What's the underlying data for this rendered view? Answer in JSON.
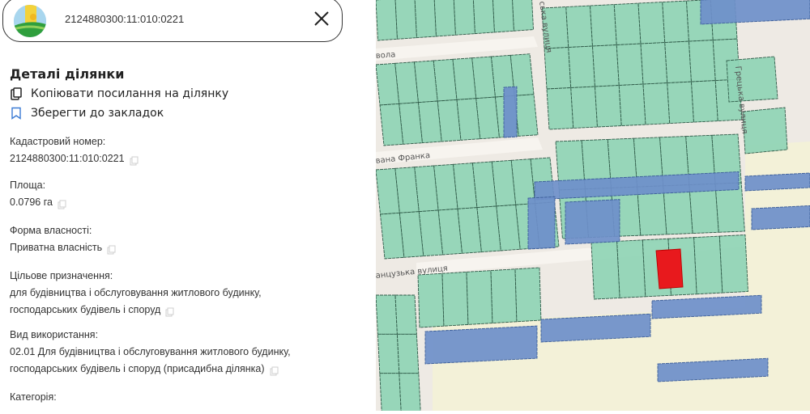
{
  "search": {
    "value": "2124880300:11:010:0221"
  },
  "details": {
    "title": "Деталі ділянки",
    "copy_link_label": "Копіювати посилання на ділянку",
    "bookmark_label": "Зберегти до закладок",
    "fields": [
      {
        "label": "Кадастровий номер:",
        "lines": [
          "2124880300:11:010:0221"
        ]
      },
      {
        "label": "Площа:",
        "lines": [
          "0.0796 га"
        ]
      },
      {
        "label": "Форма власності:",
        "lines": [
          "Приватна власність"
        ]
      },
      {
        "label": "Цільове призначення:",
        "lines": [
          "для будівництва і обслуговування житлового будинку,",
          "господарських будівель і споруд"
        ]
      },
      {
        "label": "Вид використання:",
        "lines": [
          "02.01 Для будівництва і обслуговування житлового будинку,",
          "господарських будівель і споруд (присадибна ділянка)"
        ]
      },
      {
        "label": "Категорія:",
        "lines": [
          ""
        ]
      }
    ]
  },
  "map": {
    "street_labels": [
      "вола",
      "ська вулиця",
      "вана Франка",
      "анцузька вулиця",
      "Грецька вулиця"
    ],
    "colors": {
      "parcel": "#8fd4b5",
      "state_parcel": "#6e8fca",
      "selected": "#e8191d",
      "road": "#eeeae4",
      "field": "#f3f1d8"
    }
  }
}
